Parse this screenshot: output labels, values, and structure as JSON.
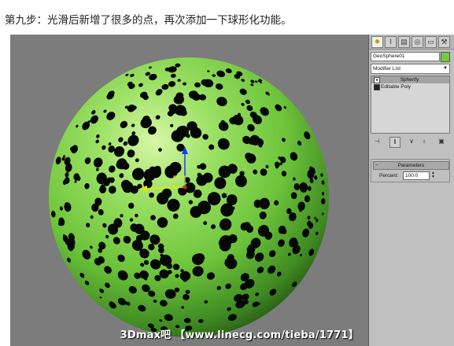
{
  "caption": "第九步：光滑后新增了很多的点，再次添加一下球形化功能。",
  "watermark": "3Dmax吧 【www.linecg.com/tieba/1771】",
  "colors": {
    "viewport_bg": "#7c7c7c",
    "sphere_green": "#6fce3a",
    "object_color_swatch": "#6fce3a",
    "hole_color": "#050805"
  },
  "panel": {
    "tabs": [
      "create-icon",
      "modify-icon",
      "hierarchy-icon",
      "motion-icon",
      "display-icon",
      "utilities-icon"
    ],
    "object_name": "GeoSphere01",
    "modifier_list_label": "Modifier List",
    "stack": [
      {
        "label": "Spherify",
        "selected": true
      },
      {
        "label": "Editable Poly",
        "selected": false
      }
    ],
    "rollout_title": "Parameters",
    "percent_label": "Percent:",
    "percent_value": "100.0"
  }
}
